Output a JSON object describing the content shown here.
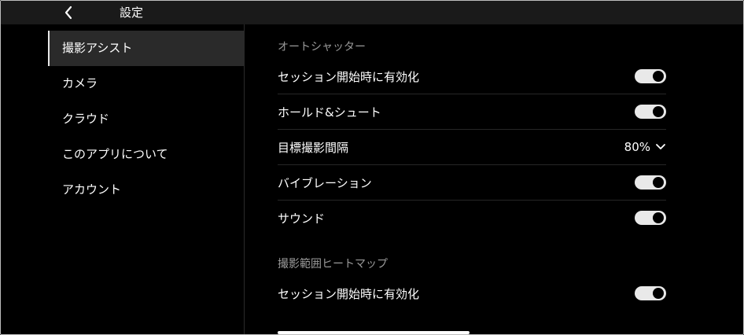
{
  "header": {
    "title": "設定"
  },
  "sidebar": {
    "items": [
      {
        "label": "撮影アシスト"
      },
      {
        "label": "カメラ"
      },
      {
        "label": "クラウド"
      },
      {
        "label": "このアプリについて"
      },
      {
        "label": "アカウント"
      }
    ],
    "selected": "撮影アシスト"
  },
  "sections": {
    "auto_shutter": {
      "title": "オートシャッター",
      "rows": [
        {
          "label": "セッション開始時に有効化",
          "toggle_on": true
        },
        {
          "label": "ホールド&シュート",
          "toggle_on": true
        },
        {
          "label": "目標撮影間隔",
          "value": "80%"
        },
        {
          "label": "バイブレーション",
          "toggle_on": true
        },
        {
          "label": "サウンド",
          "toggle_on": true
        }
      ]
    },
    "heatmap": {
      "title": "撮影範囲ヒートマップ",
      "rows": [
        {
          "label": "セッション開始時に有効化",
          "toggle_on": true
        }
      ]
    }
  },
  "colors": {
    "background": "#000000",
    "topbar": "#1a1a1a",
    "selected_item": "#2a2a2a",
    "section_title": "#9a9a9a",
    "toggle_track": "#e9e9e9"
  }
}
